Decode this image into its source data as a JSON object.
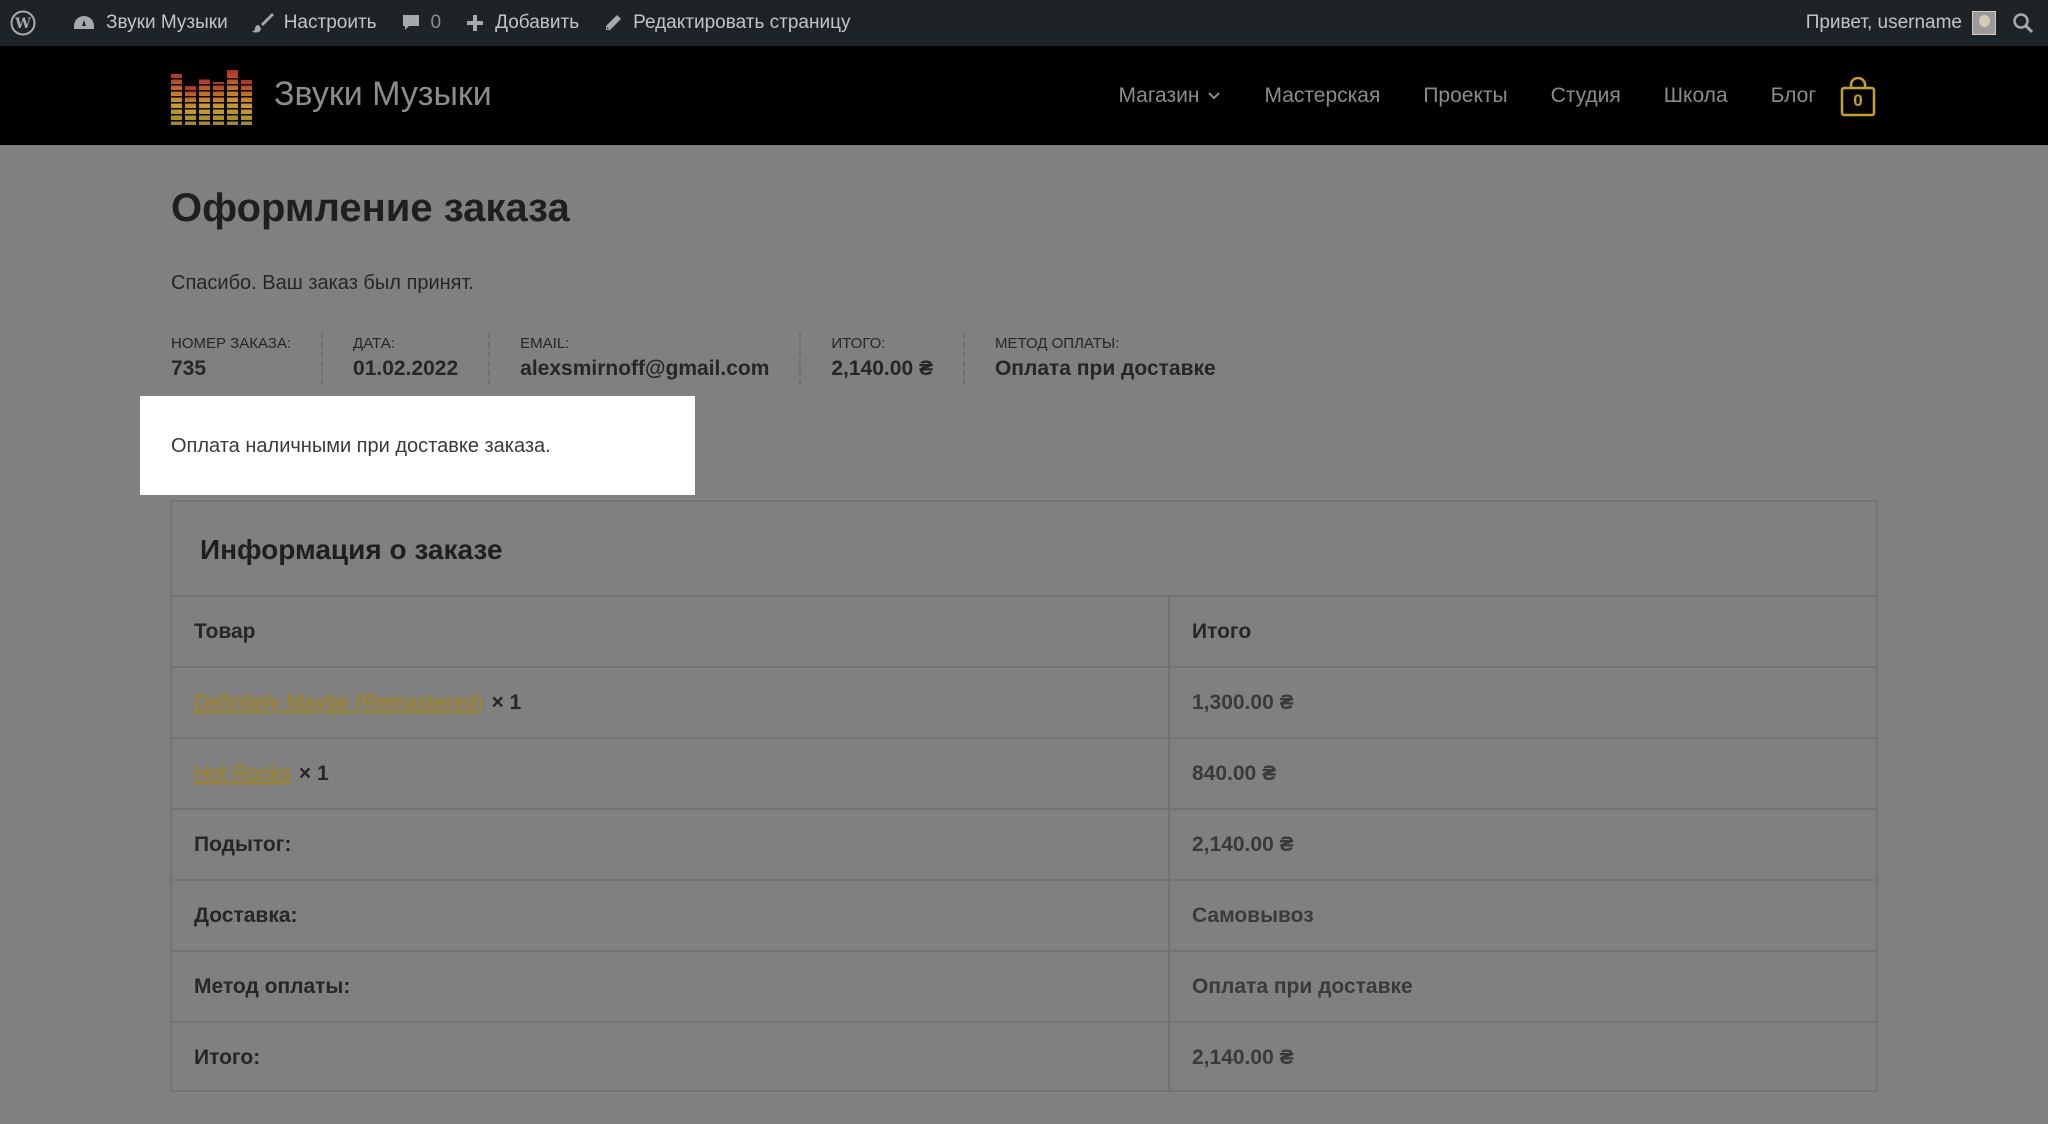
{
  "admin_bar": {
    "site_name": "Звуки Музыки",
    "customize": "Настроить",
    "comments_count": "0",
    "add_new": "Добавить",
    "edit_page": "Редактировать страницу",
    "greeting": "Привет, username"
  },
  "header": {
    "site_title": "Звуки Музыки",
    "nav": [
      "Магазин",
      "Мастерская",
      "Проекты",
      "Студия",
      "Школа",
      "Блог"
    ],
    "cart_count": "0"
  },
  "page": {
    "title": "Оформление заказа",
    "thanks": "Спасибо. Ваш заказ был принят."
  },
  "overview": [
    {
      "label": "Номер заказа:",
      "value": "735"
    },
    {
      "label": "Дата:",
      "value": "01.02.2022"
    },
    {
      "label": "Email:",
      "value": "alexsmirnoff@gmail.com"
    },
    {
      "label": "Итого:",
      "value": "2,140.00 ₴"
    },
    {
      "label": "Метод оплаты:",
      "value": "Оплата при доставке"
    }
  ],
  "notice": "Оплата наличными при доставке заказа.",
  "order_details": {
    "title": "Информация о заказе",
    "head": {
      "product": "Товар",
      "total": "Итого"
    },
    "items": [
      {
        "name": "Definitely Maybe (Remastered)",
        "qty": "× 1",
        "total": "1,300.00 ₴"
      },
      {
        "name": "Hot Rocks",
        "qty": "× 1",
        "total": "840.00 ₴"
      }
    ],
    "totals": [
      {
        "label": "Подытог:",
        "value": "2,140.00 ₴"
      },
      {
        "label": "Доставка:",
        "value": "Самовывоз"
      },
      {
        "label": "Метод оплаты:",
        "value": "Оплата при доставке"
      },
      {
        "label": "Итого:",
        "value": "2,140.00 ₴"
      }
    ]
  },
  "colors": {
    "admin_bar": "#1d2327",
    "header": "#000000",
    "overlay": "#808080",
    "accent": "#c5a219"
  }
}
